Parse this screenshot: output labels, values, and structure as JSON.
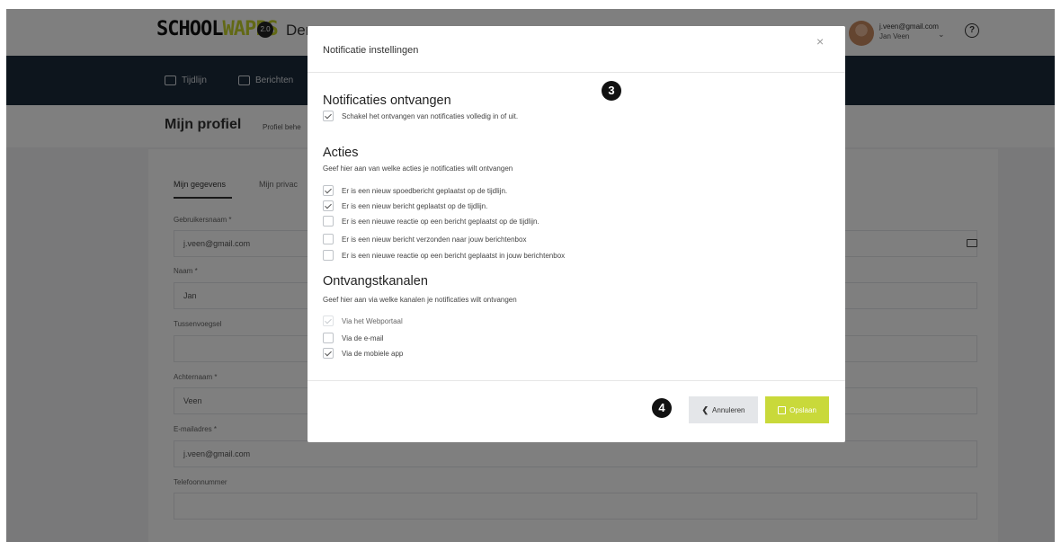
{
  "header": {
    "logo_part1": "SCHOOL",
    "logo_part2": "WAPPS",
    "logo_badge": "2.0",
    "school_name": "Der",
    "user_email": "j.veen@gmail.com",
    "user_name": "Jan Veen"
  },
  "nav": {
    "items": [
      {
        "label": "Tijdlijn",
        "icon": "timeline-icon"
      },
      {
        "label": "Berichten",
        "icon": "mail-icon"
      }
    ]
  },
  "profile": {
    "title": "Mijn profiel",
    "subtitle": "Profiel behe",
    "tabs": [
      "Mijn gegevens",
      "Mijn privac"
    ],
    "fields": [
      {
        "label": "Gebruikersnaam *",
        "value": "j.veen@gmail.com"
      },
      {
        "label": "Naam *",
        "value": "Jan"
      },
      {
        "label": "Tussenvoegsel",
        "value": ""
      },
      {
        "label": "Achternaam *",
        "value": "Veen"
      },
      {
        "label": "E-mailadres *",
        "value": "j.veen@gmail.com"
      },
      {
        "label": "Telefoonnummer",
        "value": ""
      }
    ]
  },
  "modal": {
    "title": "Notificatie instellingen",
    "close_symbol": "×",
    "step_markers": [
      "3",
      "4"
    ],
    "sections": {
      "receive": {
        "title": "Notificaties ontvangen",
        "option": {
          "label": "Schakel het ontvangen van notificaties volledig in of uit.",
          "checked": true
        }
      },
      "actions": {
        "title": "Acties",
        "description": "Geef hier aan van welke acties je notificaties wilt ontvangen",
        "options": [
          {
            "label": "Er is een nieuw spoedbericht geplaatst op de tijdlijn.",
            "checked": true
          },
          {
            "label": "Er is een nieuw bericht geplaatst op de tijdlijn.",
            "checked": true
          },
          {
            "label": "Er is een nieuwe reactie op een bericht geplaatst op de tijdlijn.",
            "checked": false
          },
          {
            "label": "Er is een nieuw bericht verzonden naar jouw berichtenbox",
            "checked": false
          },
          {
            "label": "Er is een nieuwe reactie op een bericht geplaatst in jouw berichtenbox",
            "checked": false
          }
        ]
      },
      "channels": {
        "title": "Ontvangstkanalen",
        "description": "Geef hier aan via welke kanalen je notificaties wilt ontvangen",
        "options": [
          {
            "label": "Via het Webportaal",
            "checked": true,
            "disabled": true
          },
          {
            "label": "Via de e-mail",
            "checked": false,
            "disabled": false
          },
          {
            "label": "Via de mobiele app",
            "checked": true,
            "disabled": false
          }
        ]
      }
    },
    "cancel_label": "Annuleren",
    "save_label": "Opslaan"
  },
  "colors": {
    "navbar": "#1b2a3a",
    "accent": "#c9d93a",
    "overlay": "rgba(0,0,0,0.5)"
  }
}
